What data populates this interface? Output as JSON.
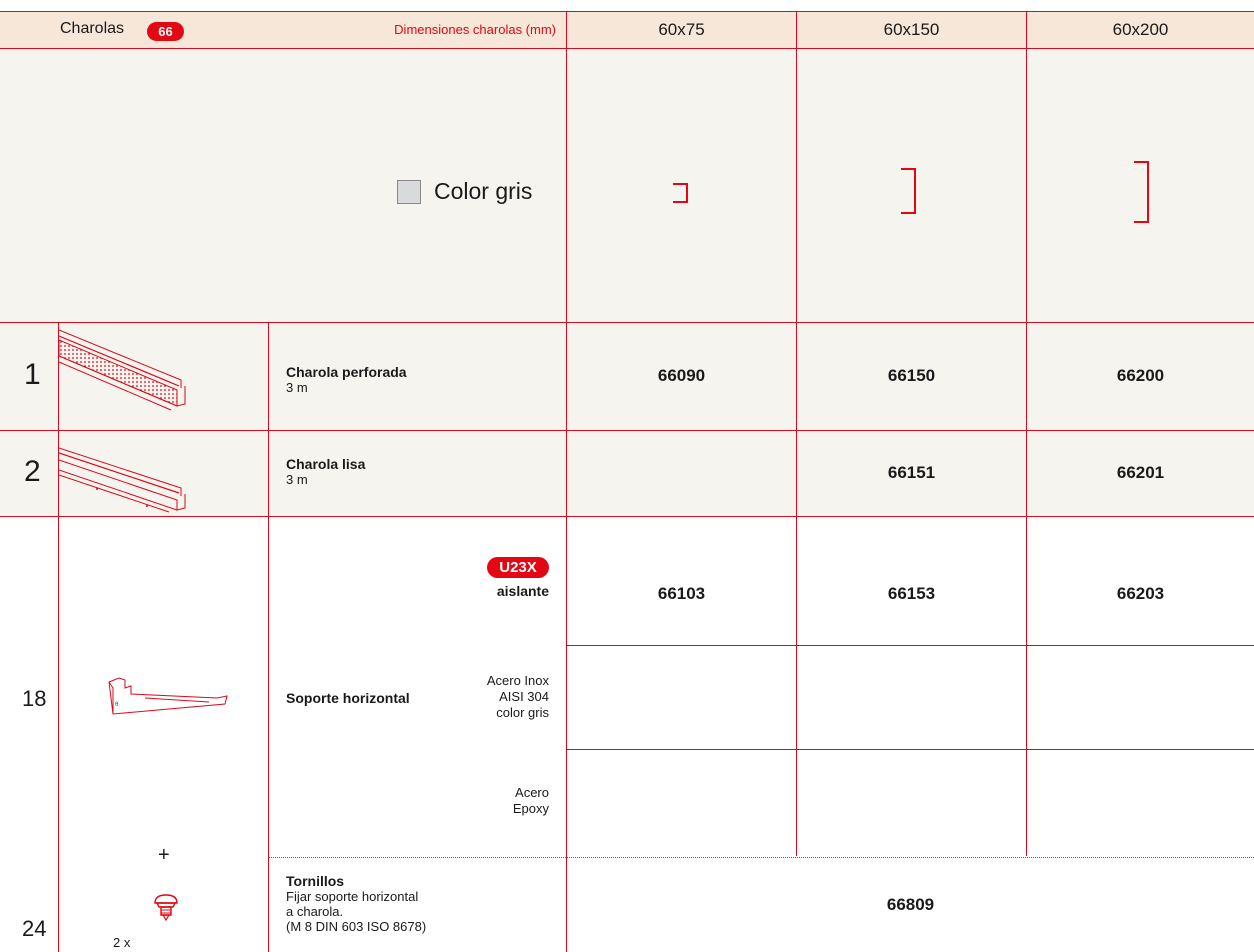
{
  "header": {
    "title": "Charolas",
    "badge": "66",
    "dims_label": "Dimensiones charolas (mm)",
    "columns": [
      "60x75",
      "60x150",
      "60x200"
    ]
  },
  "color_row": {
    "label": "Color gris",
    "swatch": "#d9dadb"
  },
  "rows": [
    {
      "num": "1",
      "name": "Charola perforada",
      "sub": "3 m",
      "codes": [
        "66090",
        "66150",
        "66200"
      ]
    },
    {
      "num": "2",
      "name": "Charola lisa",
      "sub": "3 m",
      "codes": [
        "",
        "66151",
        "66201"
      ]
    }
  ],
  "soporte": {
    "num": "18",
    "name": "Soporte horizontal",
    "badge": "U23X",
    "variants": [
      {
        "label": "aislante",
        "codes": [
          "66103",
          "66153",
          "66203"
        ]
      },
      {
        "label_lines": [
          "Acero Inox",
          "AISI 304",
          "color gris"
        ],
        "codes": [
          "",
          "",
          ""
        ]
      },
      {
        "label_lines": [
          "Acero",
          "Epoxy"
        ],
        "codes": [
          "",
          "",
          ""
        ]
      }
    ]
  },
  "tornillos": {
    "num": "24",
    "plus": "+",
    "qty": "2 x",
    "name": "Tornillos",
    "desc": [
      "Fijar soporte horizontal",
      "a charola.",
      "(M 8 DIN 603 ISO 8678)"
    ],
    "code": "66809"
  },
  "colors": {
    "accent": "#e30613",
    "header_bg": "#f6e7d8",
    "row_bg": "#f6f4ee"
  }
}
